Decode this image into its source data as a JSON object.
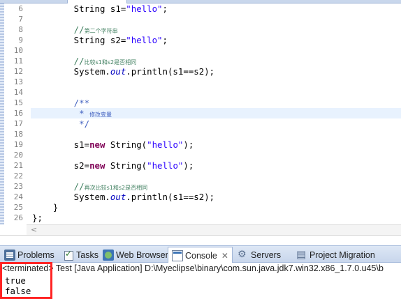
{
  "editor": {
    "lines": [
      {
        "num": "6",
        "segments": [
          {
            "t": "        String s1=",
            "c": ""
          },
          {
            "t": "\"hello\"",
            "c": "str"
          },
          {
            "t": ";",
            "c": ""
          }
        ]
      },
      {
        "num": "7",
        "segments": []
      },
      {
        "num": "8",
        "segments": [
          {
            "t": "        //",
            "c": "cmt"
          },
          {
            "t": "第二个字符串",
            "c": "cn-comment"
          }
        ]
      },
      {
        "num": "9",
        "segments": [
          {
            "t": "        String s2=",
            "c": ""
          },
          {
            "t": "\"hello\"",
            "c": "str"
          },
          {
            "t": ";",
            "c": ""
          }
        ]
      },
      {
        "num": "10",
        "segments": []
      },
      {
        "num": "11",
        "segments": [
          {
            "t": "        //",
            "c": "cmt"
          },
          {
            "t": "比较s1和s2是否相同",
            "c": "cn-comment"
          }
        ]
      },
      {
        "num": "12",
        "segments": [
          {
            "t": "        System.",
            "c": ""
          },
          {
            "t": "out",
            "c": "field"
          },
          {
            "t": ".println(s1==s2);",
            "c": ""
          }
        ]
      },
      {
        "num": "13",
        "segments": []
      },
      {
        "num": "14",
        "segments": []
      },
      {
        "num": "15",
        "segments": [
          {
            "t": "        /**",
            "c": "jdoc"
          }
        ]
      },
      {
        "num": "16",
        "segments": [
          {
            "t": "         * ",
            "c": "jdoc"
          },
          {
            "t": "修改变量",
            "c": "cn-jdoc"
          }
        ]
      },
      {
        "num": "17",
        "segments": [
          {
            "t": "         */",
            "c": "jdoc"
          }
        ]
      },
      {
        "num": "18",
        "segments": []
      },
      {
        "num": "19",
        "segments": [
          {
            "t": "        s1=",
            "c": ""
          },
          {
            "t": "new",
            "c": "kw"
          },
          {
            "t": " String(",
            "c": ""
          },
          {
            "t": "\"hello\"",
            "c": "str"
          },
          {
            "t": ");",
            "c": ""
          }
        ]
      },
      {
        "num": "20",
        "segments": []
      },
      {
        "num": "21",
        "segments": [
          {
            "t": "        s2=",
            "c": ""
          },
          {
            "t": "new",
            "c": "kw"
          },
          {
            "t": " String(",
            "c": ""
          },
          {
            "t": "\"hello\"",
            "c": "str"
          },
          {
            "t": ");",
            "c": ""
          }
        ]
      },
      {
        "num": "22",
        "segments": []
      },
      {
        "num": "23",
        "segments": [
          {
            "t": "        //",
            "c": "cmt"
          },
          {
            "t": "再次比较s1和s2是否相同",
            "c": "cn-comment"
          }
        ]
      },
      {
        "num": "24",
        "segments": [
          {
            "t": "        System.",
            "c": ""
          },
          {
            "t": "out",
            "c": "field"
          },
          {
            "t": ".println(s1==s2);",
            "c": ""
          }
        ]
      },
      {
        "num": "25",
        "segments": [
          {
            "t": "    }",
            "c": ""
          }
        ]
      },
      {
        "num": "26",
        "segments": [
          {
            "t": "}",
            "c": ""
          },
          {
            "t": ";",
            "c": ""
          }
        ]
      }
    ],
    "fold_marker_line": "15",
    "fold_marker_glyph": "−",
    "scroll_left_glyph": "<"
  },
  "view_tabs": [
    {
      "label": "Problems",
      "icon": "problems-icon",
      "active": false
    },
    {
      "label": "Tasks",
      "icon": "tasks-icon",
      "active": false
    },
    {
      "label": "Web Browser",
      "icon": "web-browser-icon",
      "active": false
    },
    {
      "label": "Console",
      "icon": "console-icon",
      "active": true,
      "close": "✕"
    },
    {
      "label": "Servers",
      "icon": "servers-icon",
      "active": false
    },
    {
      "label": "Project Migration",
      "icon": "project-migration-icon",
      "active": false
    }
  ],
  "console": {
    "header": "<terminated> Test [Java Application] D:\\Myeclipse\\binary\\com.sun.java.jdk7.win32.x86_1.7.0.u45\\b",
    "output": [
      "true",
      "false"
    ]
  },
  "colors": {
    "keyword": "#7f0055",
    "string": "#2a00ff",
    "comment": "#3f7f5f",
    "javadoc": "#3f5fbf",
    "highlight_box": "#ff2424",
    "current_line": "#e8f2fe"
  }
}
